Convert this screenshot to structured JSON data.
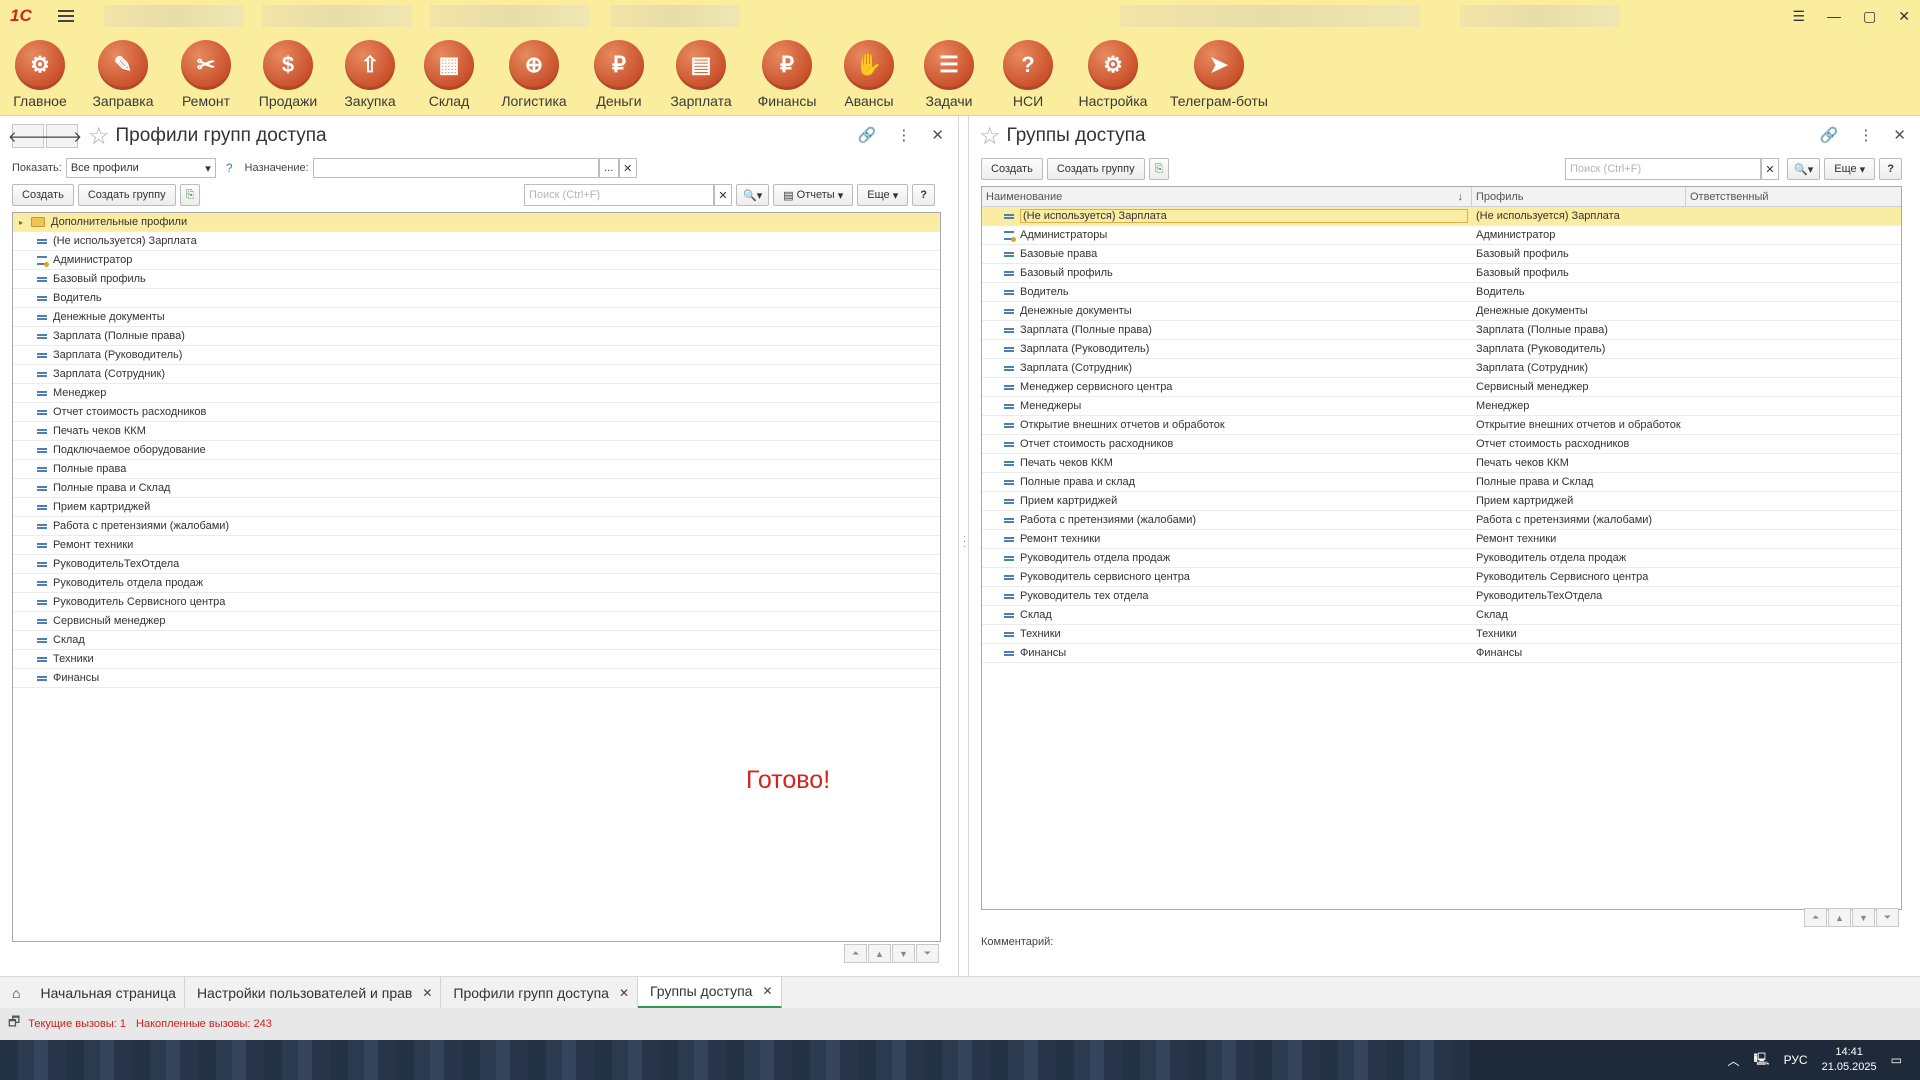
{
  "app": {
    "logo_text": "1С"
  },
  "window": {
    "minimize": "—",
    "maximize": "▢",
    "close": "✕"
  },
  "sections": [
    {
      "label": "Главное",
      "icon": "main-icon",
      "glyph": "⚙"
    },
    {
      "label": "Заправка",
      "icon": "refill-icon",
      "glyph": "✎"
    },
    {
      "label": "Ремонт",
      "icon": "repair-icon",
      "glyph": "✂"
    },
    {
      "label": "Продажи",
      "icon": "sales-icon",
      "glyph": "$"
    },
    {
      "label": "Закупка",
      "icon": "purchase-icon",
      "glyph": "⇧"
    },
    {
      "label": "Склад",
      "icon": "warehouse-icon",
      "glyph": "▦"
    },
    {
      "label": "Логистика",
      "icon": "logistics-icon",
      "glyph": "⊕"
    },
    {
      "label": "Деньги",
      "icon": "money-icon",
      "glyph": "₽"
    },
    {
      "label": "Зарплата",
      "icon": "salary-icon",
      "glyph": "▤"
    },
    {
      "label": "Финансы",
      "icon": "finance-icon",
      "glyph": "₽"
    },
    {
      "label": "Авансы",
      "icon": "advances-icon",
      "glyph": "✋"
    },
    {
      "label": "Задачи",
      "icon": "tasks-icon",
      "glyph": "☰"
    },
    {
      "label": "НСИ",
      "icon": "nsi-icon",
      "glyph": "?"
    },
    {
      "label": "Настройка",
      "icon": "settings-icon",
      "glyph": "⚙"
    },
    {
      "label": "Телеграм-боты",
      "icon": "telegram-icon",
      "glyph": "➤"
    }
  ],
  "left_form": {
    "title": "Профили групп доступа",
    "show_label": "Показать:",
    "show_value": "Все профили",
    "help_mark": "?",
    "purpose_label": "Назначение:",
    "purpose_value": "",
    "purpose_dots": "...",
    "create_label": "Создать",
    "create_group_label": "Создать группу",
    "search_placeholder": "Поиск (Ctrl+F)",
    "reports_label": "Отчеты",
    "more_label": "Еще",
    "help_label": "?",
    "folder_row": "Дополнительные профили",
    "rows": [
      "(Не используется) Зарплата",
      "Администратор",
      "Базовый профиль",
      "Водитель",
      "Денежные документы",
      "Зарплата (Полные права)",
      "Зарплата (Руководитель)",
      "Зарплата (Сотрудник)",
      "Менеджер",
      "Отчет стоимость расходников",
      "Печать чеков ККМ",
      "Подключаемое оборудование",
      "Полные права",
      "Полные права и Склад",
      "Прием картриджей",
      "Работа с претензиями (жалобами)",
      "Ремонт техники",
      "РуководительТехОтдела",
      "Руководитель отдела продаж",
      "Руководитель Сервисного центра",
      "Сервисный менеджер",
      "Склад",
      "Техники",
      "Финансы"
    ],
    "done_text": "Готово!"
  },
  "right_form": {
    "title": "Группы доступа",
    "create_label": "Создать",
    "create_group_label": "Создать группу",
    "search_placeholder": "Поиск (Ctrl+F)",
    "more_label": "Еще",
    "help_label": "?",
    "columns": {
      "name": "Наименование",
      "profile": "Профиль",
      "responsible": "Ответственный",
      "sort_mark": "↓"
    },
    "rows": [
      {
        "name": "(Не используется) Зарплата",
        "profile": "(Не используется) Зарплата"
      },
      {
        "name": "Администраторы",
        "profile": "Администратор"
      },
      {
        "name": "Базовые права",
        "profile": "Базовый профиль"
      },
      {
        "name": "Базовый профиль",
        "profile": "Базовый профиль"
      },
      {
        "name": "Водитель",
        "profile": "Водитель"
      },
      {
        "name": "Денежные документы",
        "profile": "Денежные документы"
      },
      {
        "name": "Зарплата (Полные права)",
        "profile": "Зарплата (Полные права)"
      },
      {
        "name": "Зарплата (Руководитель)",
        "profile": "Зарплата (Руководитель)"
      },
      {
        "name": "Зарплата (Сотрудник)",
        "profile": "Зарплата (Сотрудник)"
      },
      {
        "name": "Менеджер сервисного центра",
        "profile": "Сервисный менеджер"
      },
      {
        "name": "Менеджеры",
        "profile": "Менеджер"
      },
      {
        "name": "Открытие внешних отчетов и обработок",
        "profile": "Открытие внешних отчетов и обработок"
      },
      {
        "name": "Отчет стоимость расходников",
        "profile": "Отчет стоимость расходников"
      },
      {
        "name": "Печать чеков ККМ",
        "profile": "Печать чеков ККМ"
      },
      {
        "name": "Полные права и склад",
        "profile": "Полные права и Склад"
      },
      {
        "name": "Прием картриджей",
        "profile": "Прием картриджей"
      },
      {
        "name": "Работа с претензиями (жалобами)",
        "profile": "Работа с претензиями (жалобами)"
      },
      {
        "name": "Ремонт техники",
        "profile": "Ремонт техники"
      },
      {
        "name": "Руководитель отдела продаж",
        "profile": "Руководитель отдела продаж"
      },
      {
        "name": "Руководитель сервисного центра",
        "profile": "Руководитель Сервисного центра"
      },
      {
        "name": "Руководитель тех отдела",
        "profile": "РуководительТехОтдела"
      },
      {
        "name": "Склад",
        "profile": "Склад"
      },
      {
        "name": "Техники",
        "profile": "Техники"
      },
      {
        "name": "Финансы",
        "profile": "Финансы"
      }
    ],
    "comment_label": "Комментарий:"
  },
  "tabs": [
    {
      "label": "Начальная страница",
      "closable": false
    },
    {
      "label": "Настройки пользователей и прав",
      "closable": true
    },
    {
      "label": "Профили групп доступа",
      "closable": true
    },
    {
      "label": "Группы доступа",
      "closable": true,
      "active": true
    }
  ],
  "status": {
    "current_calls": "Текущие вызовы: 1",
    "accumulated_calls": "Накопленные вызовы: 243"
  },
  "taskbar": {
    "lang": "РУС",
    "time": "14:41",
    "date": "21.05.2025"
  },
  "colors": {
    "accent_yellow": "#fbed9e",
    "selection": "#fbeca3",
    "active_tab": "#2e9e4a",
    "done_text": "#d5241c"
  }
}
